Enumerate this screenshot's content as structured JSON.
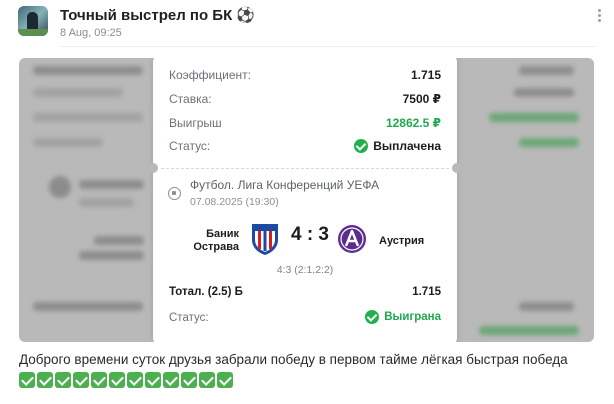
{
  "post": {
    "channel_name": "Точный выстрел по БК ⚽",
    "date": "8 Aug, 09:25",
    "caption": "Доброго времени суток друзья забрали победу в первом тайме лёгкая быстрая победа",
    "check_emoji_count": 12
  },
  "bet_card": {
    "coefficient_label": "Коэффициент:",
    "coefficient_value": "1.715",
    "stake_label": "Ставка:",
    "stake_value": "7500 ₽",
    "payout_label": "Выигрыш",
    "payout_value": "12862.5 ₽",
    "status_label": "Статус:",
    "status_value": "Выплачена",
    "event": {
      "league": "Футбол. Лига Конференций УЕФА",
      "date": "07.08.2025 (19:30)",
      "home_team_line1": "Баник",
      "home_team_line2": "Острава",
      "away_team": "Аустрия",
      "score": "4 : 3",
      "score_detail": "4:3 (2:1,2:2)",
      "market_label": "Тотал. (2.5) Б",
      "market_value": "1.715",
      "result_label": "Статус:",
      "result_value": "Выиграна"
    }
  },
  "colors": {
    "win_green": "#1fa84f",
    "check_green": "#4caf50",
    "banik_blue": "#1d4aa0",
    "banik_red": "#d32027",
    "austria_violet": "#5b2d8e"
  }
}
